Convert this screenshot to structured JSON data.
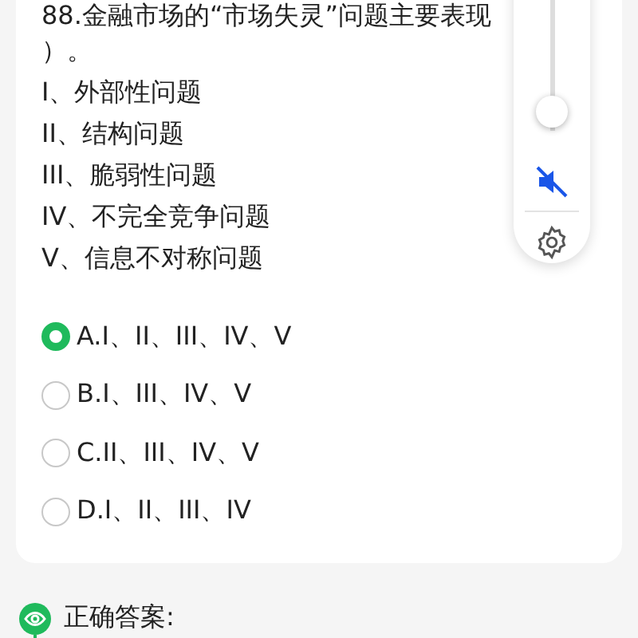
{
  "question": {
    "stem_lines": [
      "88.金融市场的“市场失灵”问题主要表现",
      "）。",
      "I、外部性问题",
      "II、结构问题",
      "III、脆弱性问题",
      "IV、不完全竞争问题",
      "V、信息不对称问题"
    ],
    "options": [
      {
        "label": "A.I、II、III、IV、V",
        "selected": true
      },
      {
        "label": "B.I、III、IV、V",
        "selected": false
      },
      {
        "label": "C.II、III、IV、V",
        "selected": false
      },
      {
        "label": "D.I、II、III、IV",
        "selected": false
      }
    ]
  },
  "answer": {
    "heading": "正确答案:"
  },
  "volume_panel": {
    "level": 0.15,
    "muted": true
  }
}
